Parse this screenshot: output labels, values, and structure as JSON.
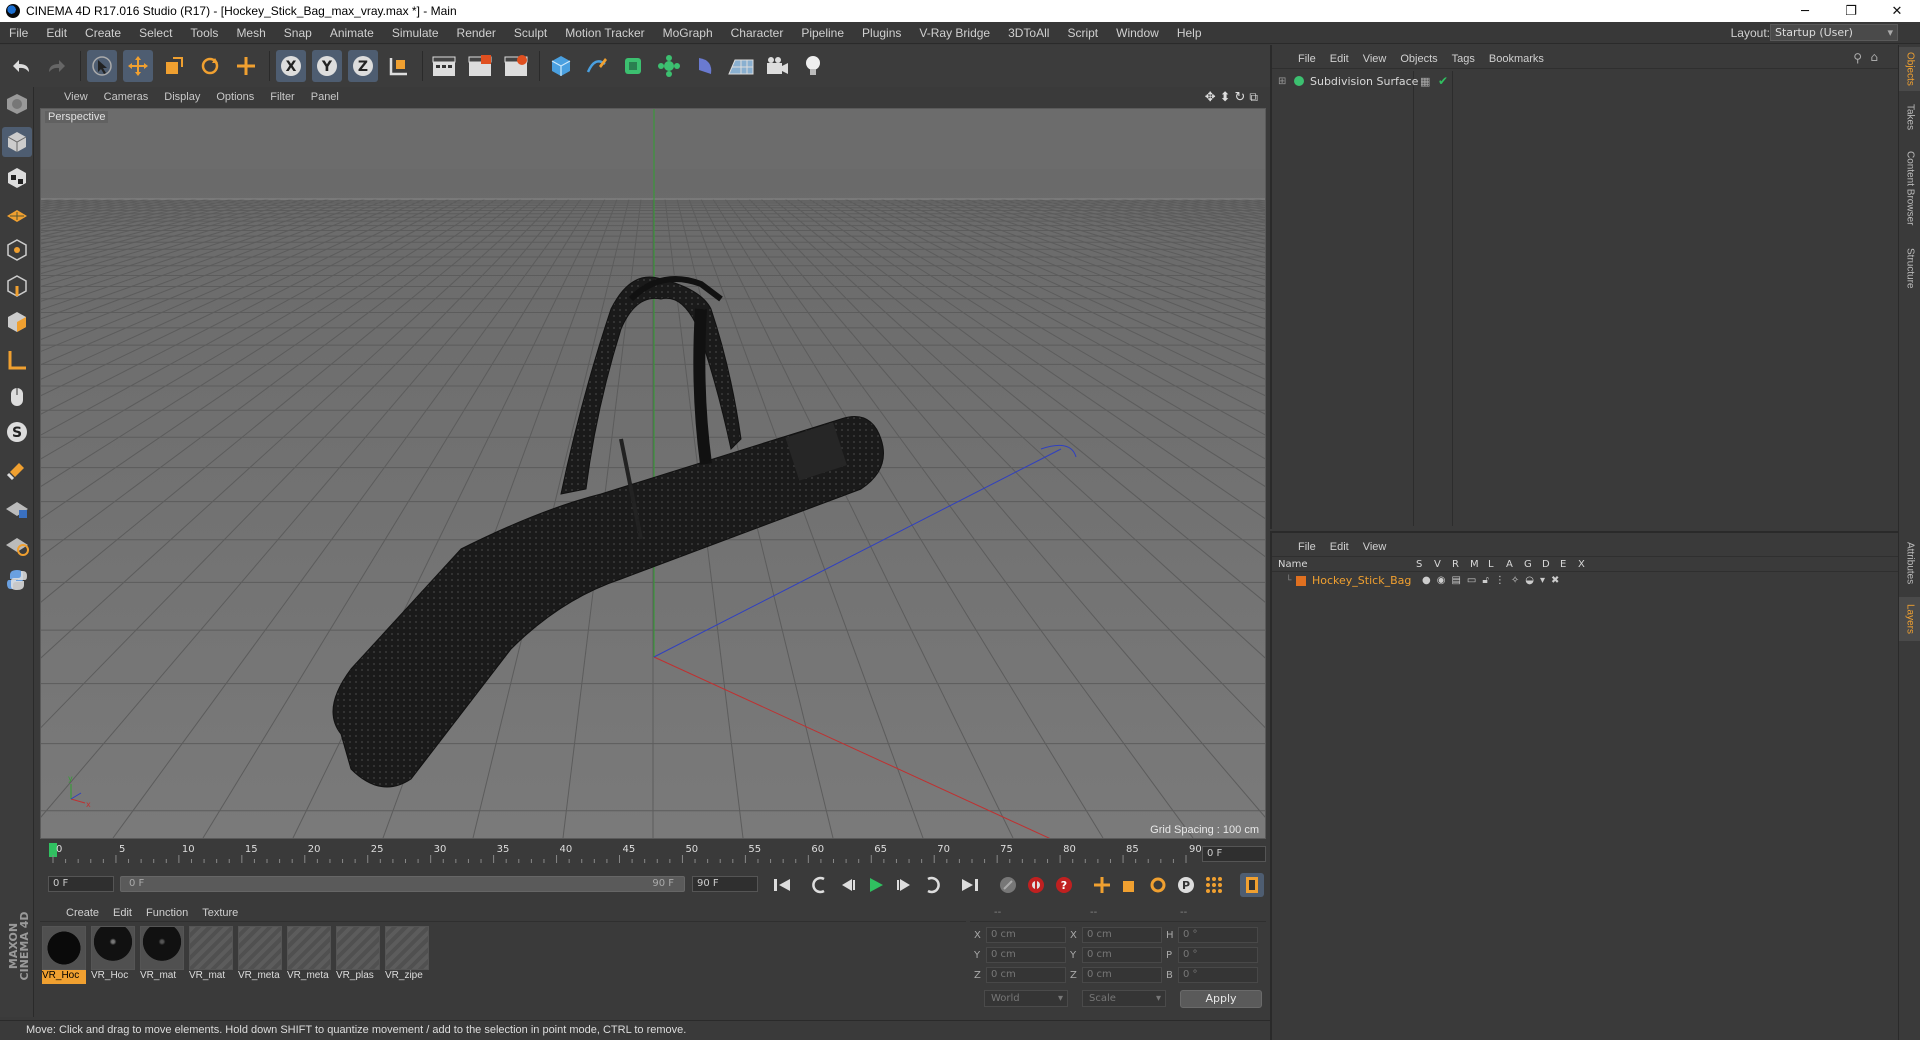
{
  "window": {
    "title": "CINEMA 4D R17.016 Studio (R17) - [Hockey_Stick_Bag_max_vray.max *] - Main",
    "minimize": "─",
    "maximize": "❐",
    "close": "✕"
  },
  "menubar": {
    "items": [
      "File",
      "Edit",
      "Create",
      "Select",
      "Tools",
      "Mesh",
      "Snap",
      "Animate",
      "Simulate",
      "Render",
      "Sculpt",
      "Motion Tracker",
      "MoGraph",
      "Character",
      "Pipeline",
      "Plugins",
      "V-Ray Bridge",
      "3DToAll",
      "Script",
      "Window",
      "Help"
    ],
    "layout_label": "Layout:",
    "layout_value": "Startup (User)"
  },
  "viewport": {
    "menu": [
      "View",
      "Cameras",
      "Display",
      "Options",
      "Filter",
      "Panel"
    ],
    "label": "Perspective",
    "grid_spacing": "Grid Spacing : 100 cm"
  },
  "timeline": {
    "ticks": [
      "0",
      "5",
      "10",
      "15",
      "20",
      "25",
      "30",
      "35",
      "40",
      "45",
      "50",
      "55",
      "60",
      "65",
      "70",
      "75",
      "80",
      "85",
      "90"
    ],
    "current_frame": "0 F",
    "start_field": "0 F",
    "range_start": "0 F",
    "range_end": "90 F",
    "end_field": "90 F"
  },
  "materials": {
    "menu": [
      "Create",
      "Edit",
      "Function",
      "Texture"
    ],
    "items": [
      {
        "label": "VR_Hoc"
      },
      {
        "label": "VR_Hoc"
      },
      {
        "label": "VR_mat"
      },
      {
        "label": "VR_mat"
      },
      {
        "label": "VR_meta"
      },
      {
        "label": "VR_meta"
      },
      {
        "label": "VR_plas"
      },
      {
        "label": "VR_zipe"
      }
    ]
  },
  "coords": {
    "header": [
      "--",
      "--",
      "--"
    ],
    "rows": [
      {
        "l1": "X",
        "v1": "0 cm",
        "l2": "X",
        "v2": "0 cm",
        "l3": "H",
        "v3": "0 °"
      },
      {
        "l1": "Y",
        "v1": "0 cm",
        "l2": "Y",
        "v2": "0 cm",
        "l3": "P",
        "v3": "0 °"
      },
      {
        "l1": "Z",
        "v1": "0 cm",
        "l2": "Z",
        "v2": "0 cm",
        "l3": "B",
        "v3": "0 °"
      }
    ],
    "mode": "World",
    "size_mode": "Scale",
    "apply": "Apply"
  },
  "objects": {
    "menu": [
      "File",
      "Edit",
      "View",
      "Objects",
      "Tags",
      "Bookmarks"
    ],
    "rows": [
      {
        "name": "Subdivision Surface"
      }
    ]
  },
  "layers": {
    "menu": [
      "File",
      "Edit",
      "View"
    ],
    "columns": [
      "Name",
      "S",
      "V",
      "R",
      "M",
      "L",
      "A",
      "G",
      "D",
      "E",
      "X"
    ],
    "rows": [
      {
        "name": "Hockey_Stick_Bag",
        "color": "#e07020"
      }
    ]
  },
  "side_tabs": [
    "Objects",
    "Takes",
    "Content Browser",
    "Structure",
    "Attributes",
    "Layers"
  ],
  "status": "Move: Click and drag to move elements. Hold down SHIFT to quantize movement / add to the selection in point mode, CTRL to remove.",
  "logo": {
    "line1": "MAXON",
    "line2": "CINEMA 4D"
  },
  "colors": {
    "accent": "#f0a030",
    "selected_tool": "#4e5d71",
    "axis_x": "#c03030",
    "axis_y": "#30a030",
    "axis_z": "#3040c0"
  }
}
